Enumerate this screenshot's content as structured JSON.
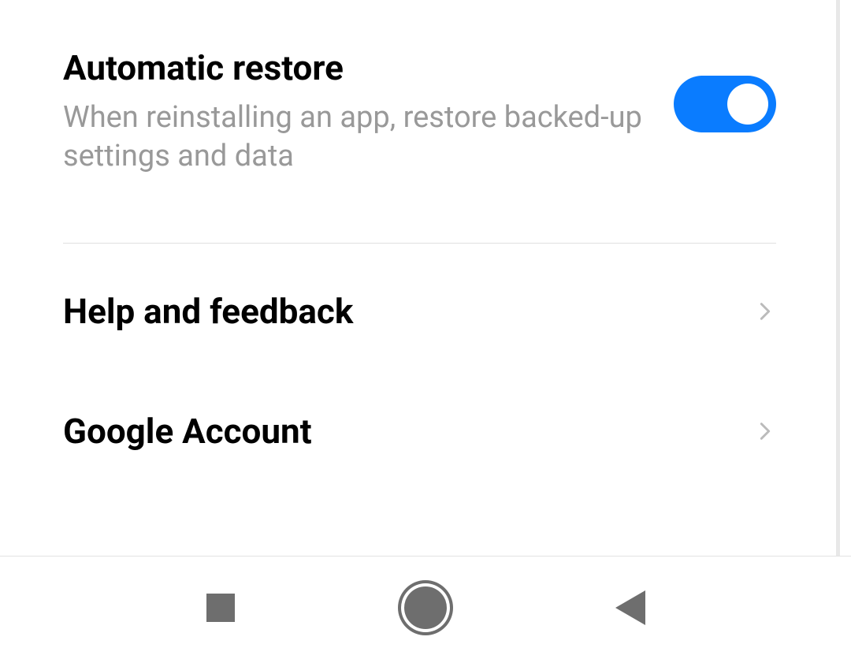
{
  "settings": {
    "automatic_restore": {
      "title": "Automatic restore",
      "subtitle": "When reinstalling an app, restore backed-up settings and data",
      "enabled": true
    },
    "help_feedback": {
      "title": "Help and feedback"
    },
    "google_account": {
      "title": "Google Account"
    }
  }
}
